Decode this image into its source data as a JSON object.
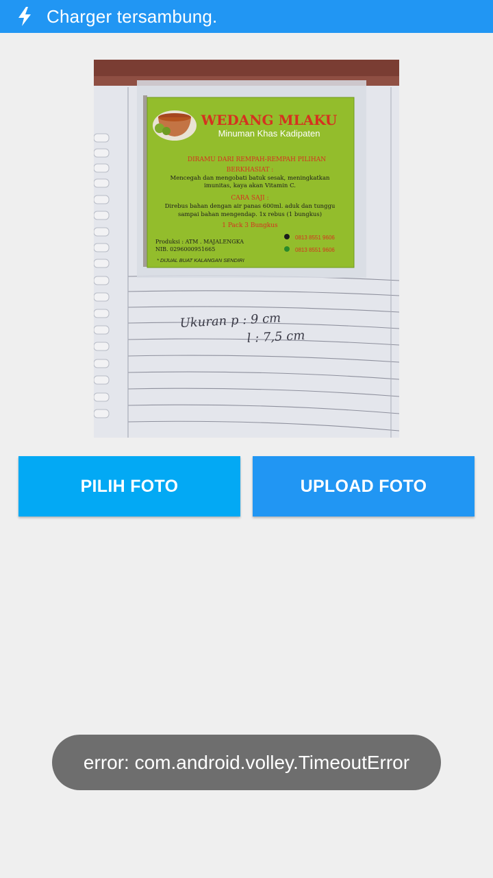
{
  "status_bar": {
    "icon": "lightning-bolt-icon",
    "text": "Charger tersambung.",
    "color": "#2196f3"
  },
  "photo": {
    "brand": "WEDANG MLAKU",
    "subtitle": "Minuman Khas Kadipaten",
    "tagline": "DIRAMU DARI REMPAH-REMPAH PILIHAN",
    "benefit_heading": "BERKHASIAT :",
    "benefit_line1": "Mencegah dan mengobati batuk sesak, meningkatkan",
    "benefit_line2": "imunitas, kaya akan Vitamin C.",
    "howto_heading": "CARA SAJI :",
    "howto_line1": "Direbus bahan dengan air panas 600ml. aduk dan tunggu",
    "howto_line2": "sampai bahan mengendap. 1x rebus (1 bungkus)",
    "pack": "1 Pack 3 Bungkus",
    "producer": "Produksi : ATM . MAJALENGKA",
    "nib": "NIB. 0296000951665",
    "phone1": "0813 8551 9606",
    "phone2": "0813 8551 9606",
    "note": "* DIJUAL BUAT KALANGAN SENDIRI",
    "handwriting_line1": "Ukuran p : 9 cm",
    "handwriting_line2": "l : 7,5 cm"
  },
  "buttons": {
    "pick_label": "PILIH FOTO",
    "upload_label": "UPLOAD FOTO",
    "pick_color": "#03a9f4",
    "upload_color": "#2196f3"
  },
  "toast": {
    "message": "error: com.android.volley.TimeoutError"
  }
}
